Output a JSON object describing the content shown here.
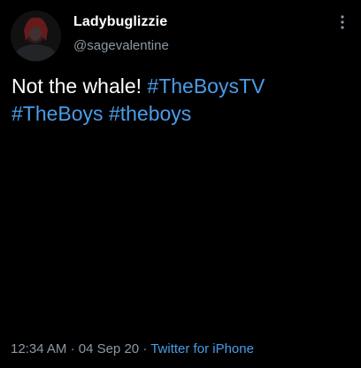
{
  "author": {
    "display_name": "Ladybuglizzie",
    "handle": "@sagevalentine",
    "avatar_icon": "profile-avatar"
  },
  "tweet": {
    "text_plain": "Not the whale!",
    "hashtags": [
      "#TheBoysTV",
      "#TheBoys",
      "#theboys"
    ]
  },
  "meta": {
    "time": "12:34 AM",
    "separator": "·",
    "date": "04 Sep 20",
    "source": "Twitter for iPhone"
  },
  "icons": {
    "more": "more-vertical-icon"
  },
  "colors": {
    "background": "#000000",
    "text": "#ffffff",
    "secondary": "#8b98a5",
    "link": "#4a9ce8"
  }
}
